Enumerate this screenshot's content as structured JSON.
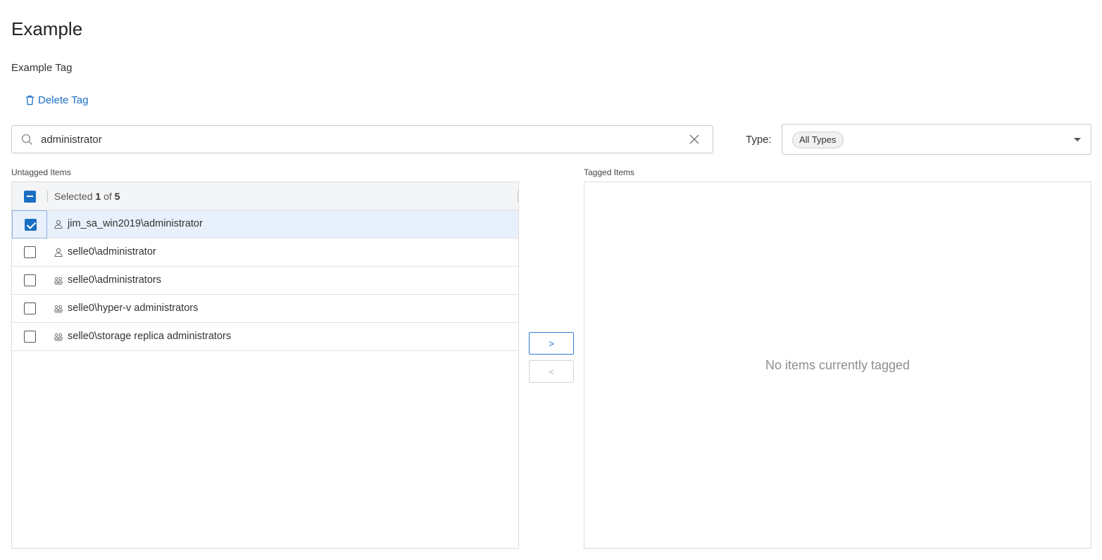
{
  "page": {
    "title": "Example",
    "tag_name": "Example Tag"
  },
  "actions": {
    "delete_tag_label": "Delete Tag"
  },
  "search": {
    "value": "administrator",
    "placeholder": ""
  },
  "type_filter": {
    "label": "Type:",
    "selected_value": "All Types"
  },
  "untagged": {
    "section_label": "Untagged Items",
    "header": {
      "selected_prefix": "Selected",
      "selected_count": "1",
      "of_label": "of",
      "total_count": "5"
    },
    "items": [
      {
        "label": "jim_sa_win2019\\administrator",
        "icon": "user-icon",
        "checked": true
      },
      {
        "label": "selle0\\administrator",
        "icon": "user-icon",
        "checked": false
      },
      {
        "label": "selle0\\administrators",
        "icon": "group-icon",
        "checked": false
      },
      {
        "label": "selle0\\hyper-v administrators",
        "icon": "group-icon",
        "checked": false
      },
      {
        "label": "selle0\\storage replica administrators",
        "icon": "group-icon",
        "checked": false
      }
    ]
  },
  "transfer": {
    "move_right_label": ">",
    "move_left_label": "<"
  },
  "tagged": {
    "section_label": "Tagged Items",
    "empty_message": "No items currently tagged"
  },
  "colors": {
    "accent": "#1a6fc4",
    "selected_row": "#e8f0fb",
    "header_bg": "#f4f5f7",
    "border": "#dcdcdc"
  }
}
